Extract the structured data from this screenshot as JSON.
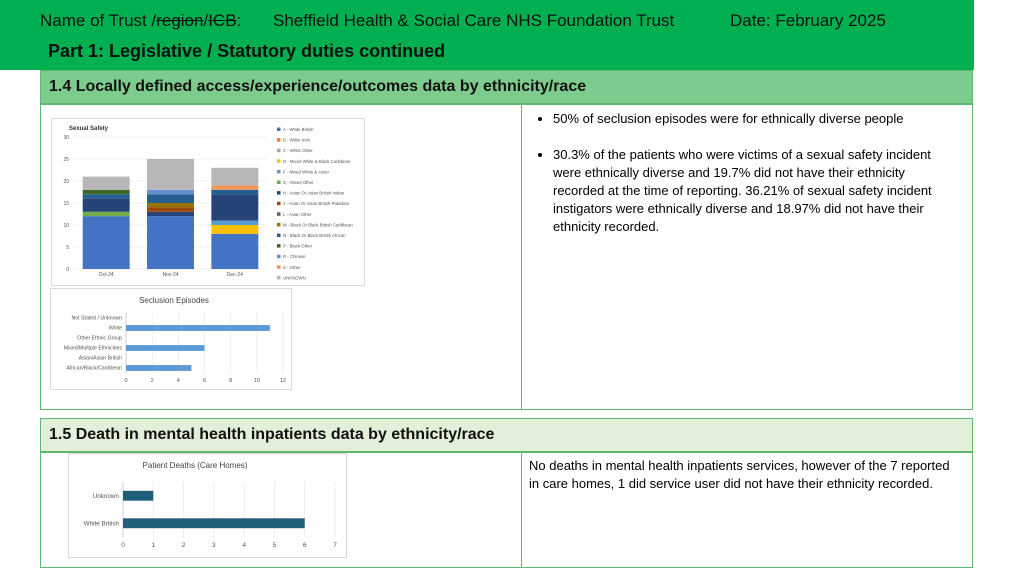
{
  "header": {
    "name_prefix": "Name of Trust /",
    "name_strike1": "region",
    "name_sep": "/",
    "name_strike2": "ICB",
    "name_colon": ":",
    "organisation": "Sheffield Health & Social Care NHS Foundation Trust",
    "date": "Date: February 2025",
    "part_title": "Part 1: Legislative / Statutory duties continued"
  },
  "section_1_4": {
    "title": "1.4 Locally defined access/experience/outcomes data by ethnicity/race",
    "bullets": [
      "50% of seclusion episodes were for ethnically diverse people",
      "30.3% of the patients who were victims of a sexual safety incident were ethnically diverse and 19.7% did not have their ethnicity recorded at the time of reporting. 36.21% of sexual safety incident instigators were ethnically diverse and 18.97% did not have their ethnicity recorded."
    ]
  },
  "section_1_5": {
    "title": "1.5 Death in mental health inpatients data by ethnicity/race",
    "text": "No deaths in mental health inpatients services, however of the 7 reported in care homes, 1 did service user did not have their ethnicity recorded."
  },
  "colors": {
    "header_green": "#00b050",
    "section_green": "#7ecb8e",
    "section_light": "#e2efd9",
    "bar_blue": "#5b9bd5",
    "bar_teal": "#1f5f7a"
  },
  "chart_data": [
    {
      "type": "bar",
      "stacked": true,
      "title": "Sexual Safety",
      "categories": [
        "Oct-24",
        "Nov-24",
        "Dec-24"
      ],
      "ylim": [
        0,
        30
      ],
      "yticks": [
        0,
        5,
        10,
        15,
        20,
        25,
        30
      ],
      "grid": true,
      "legend_position": "right",
      "series": [
        {
          "name": "A - White British",
          "color": "#4472c4",
          "values": [
            12,
            12,
            8
          ]
        },
        {
          "name": "B - White Irish",
          "color": "#ed7d31",
          "values": [
            0,
            0,
            0
          ]
        },
        {
          "name": "C - White Other",
          "color": "#a5a5a5",
          "values": [
            0,
            0,
            0
          ]
        },
        {
          "name": "D - Mixed White & Black Caribbean",
          "color": "#ffc000",
          "values": [
            0,
            0,
            2
          ]
        },
        {
          "name": "F - Mixed White & Asian",
          "color": "#5b9bd5",
          "values": [
            0,
            0,
            1
          ]
        },
        {
          "name": "G - Mixed Other",
          "color": "#70ad47",
          "values": [
            1,
            0,
            0
          ]
        },
        {
          "name": "H - Asian Or Asian British Indian",
          "color": "#264478",
          "values": [
            3,
            1,
            6
          ]
        },
        {
          "name": "J - Asian Or Asian British Pakistani",
          "color": "#9e480e",
          "values": [
            0,
            1,
            0
          ]
        },
        {
          "name": "L - Asian Other",
          "color": "#636363",
          "values": [
            0,
            0,
            0
          ]
        },
        {
          "name": "M - Black Or Black British Caribbean",
          "color": "#997300",
          "values": [
            0,
            1,
            0
          ]
        },
        {
          "name": "N - Black Or Black British African",
          "color": "#255e91",
          "values": [
            1,
            2,
            1
          ]
        },
        {
          "name": "P - Black Other",
          "color": "#43682b",
          "values": [
            1,
            0,
            0
          ]
        },
        {
          "name": "R - Chinese",
          "color": "#698ed0",
          "values": [
            0,
            1,
            0
          ]
        },
        {
          "name": "S - Other",
          "color": "#f1975a",
          "values": [
            0,
            0,
            1
          ]
        },
        {
          "name": "UNKNOWN",
          "color": "#b7b7b7",
          "values": [
            3,
            7,
            4
          ]
        }
      ]
    },
    {
      "type": "bar",
      "orientation": "horizontal",
      "title": "Seclusion Episodes",
      "categories": [
        "Not Stated / Unknown",
        "White",
        "Other Ethnic Group",
        "Mixed/Multiple Ethnicities",
        "Asian/Asian British",
        "African/Black/Caribbean"
      ],
      "values": [
        0,
        11,
        0,
        6,
        0,
        5
      ],
      "xlim": [
        0,
        12
      ],
      "xticks": [
        0,
        2,
        4,
        6,
        8,
        10,
        12
      ],
      "grid": true
    },
    {
      "type": "bar",
      "orientation": "horizontal",
      "title": "Patient Deaths (Care Homes)",
      "categories": [
        "Unknown",
        "White British"
      ],
      "values": [
        1,
        6
      ],
      "xlim": [
        0,
        7
      ],
      "xticks": [
        0,
        1,
        2,
        3,
        4,
        5,
        6,
        7
      ],
      "grid": true
    }
  ]
}
